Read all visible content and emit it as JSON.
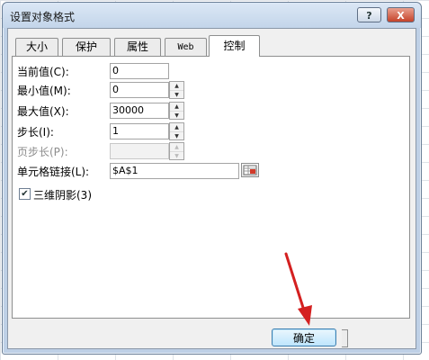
{
  "dialog": {
    "title": "设置对象格式",
    "help_label": "?",
    "close_label": "X"
  },
  "tabs": [
    {
      "label": "大小",
      "active": false
    },
    {
      "label": "保护",
      "active": false
    },
    {
      "label": "属性",
      "active": false
    },
    {
      "label": "Web",
      "active": false
    },
    {
      "label": "控制",
      "active": true
    }
  ],
  "form": {
    "current_value": {
      "label": "当前值(C):",
      "value": "0"
    },
    "min_value": {
      "label": "最小值(M):",
      "value": "0"
    },
    "max_value": {
      "label": "最大值(X):",
      "value": "30000"
    },
    "step": {
      "label": "步长(I):",
      "value": "1"
    },
    "page_step": {
      "label": "页步长(P):",
      "value": "",
      "disabled": true
    },
    "cell_link": {
      "label": "单元格链接(L):",
      "value": "$A$1"
    },
    "shading": {
      "label": "三维阴影(3)",
      "checked": true
    }
  },
  "buttons": {
    "ok_label": "确定"
  },
  "colors": {
    "title_bar": "#c3d5ea",
    "close_button": "#c5432a",
    "ok_button": "#bee6fd",
    "annotation_arrow": "#d42020"
  },
  "icons": {
    "spin_up": "▲",
    "spin_down": "▼",
    "check": "✔"
  }
}
